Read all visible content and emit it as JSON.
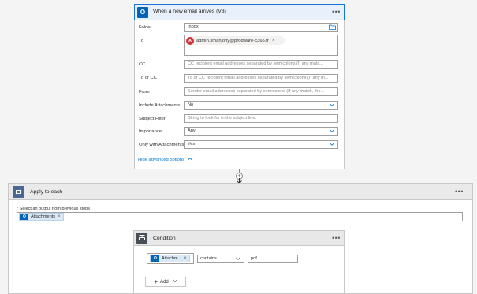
{
  "trigger": {
    "title": "When a new email arrives (V3)",
    "menu": "•••",
    "fields": {
      "folder": {
        "label": "Folder",
        "value": "Inbox"
      },
      "to": {
        "label": "To",
        "recipient": "admin.smanjony@prodware-c365.fr",
        "avatar_letter": "A"
      },
      "cc": {
        "label": "CC",
        "placeholder": "CC recipient email addresses separated by semicolons (If any matc..."
      },
      "to_or_cc": {
        "label": "To or CC",
        "placeholder": "To or CC recipient email addresses separated by semicolons (If any m..."
      },
      "from": {
        "label": "From",
        "placeholder": "Sender email addresses separated by semicolons (If any match, the..."
      },
      "include_attachments": {
        "label": "Include Attachments",
        "value": "No"
      },
      "subject_filter": {
        "label": "Subject Filter",
        "placeholder": "String to look for in the subject line."
      },
      "importance": {
        "label": "Importance",
        "value": "Any"
      },
      "only_with_attachments": {
        "label": "Only with Attachments",
        "value": "Yes"
      }
    },
    "hide_advanced": "Hide advanced options"
  },
  "apply_to_each": {
    "title": "Apply to each",
    "menu": "•••",
    "select_label": "* Select an output from previous steps",
    "token": "Attachments"
  },
  "condition": {
    "title": "Condition",
    "menu": "•••",
    "left_token": "Attachm...",
    "operator": "contains",
    "right_value": "pdf",
    "add_label": "Add"
  },
  "colors": {
    "accent": "#0078d4",
    "office_blue": "#0364b8",
    "loop_icon": "#486991",
    "condition_icon": "#484f58"
  },
  "icons": {
    "trigger": "outlook-icon",
    "loop": "loop-icon",
    "condition": "condition-icon",
    "folder_picker": "folder-picker-icon"
  }
}
